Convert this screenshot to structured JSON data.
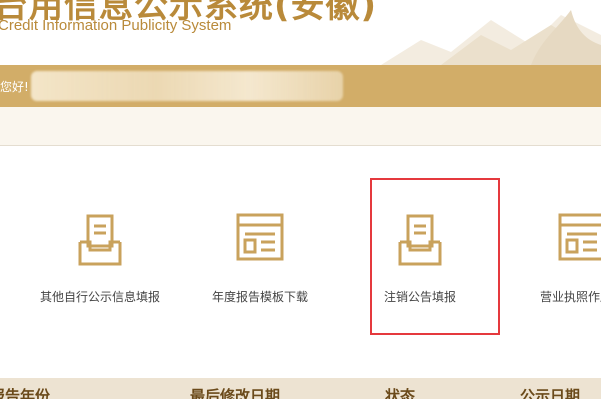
{
  "header": {
    "title": "台用信息公示系统(安徽)",
    "subtitle": "Credit Information Publicity System"
  },
  "welcome": {
    "greeting": "您好!"
  },
  "tiles": [
    {
      "label": "其他自行公示信息填报",
      "icon": "inbox-document-icon"
    },
    {
      "label": "年度报告模板下载",
      "icon": "browser-window-icon"
    },
    {
      "label": "注销公告填报",
      "icon": "inbox-document-icon"
    },
    {
      "label": "营业执照作废声",
      "icon": "browser-window-icon"
    }
  ],
  "table": {
    "headers": [
      "报告年份",
      "最后修改日期",
      "状态",
      "公示日期"
    ]
  },
  "colors": {
    "brand": "#d2ad68",
    "brand_text": "#b98a3a",
    "highlight": "#e5393d"
  }
}
